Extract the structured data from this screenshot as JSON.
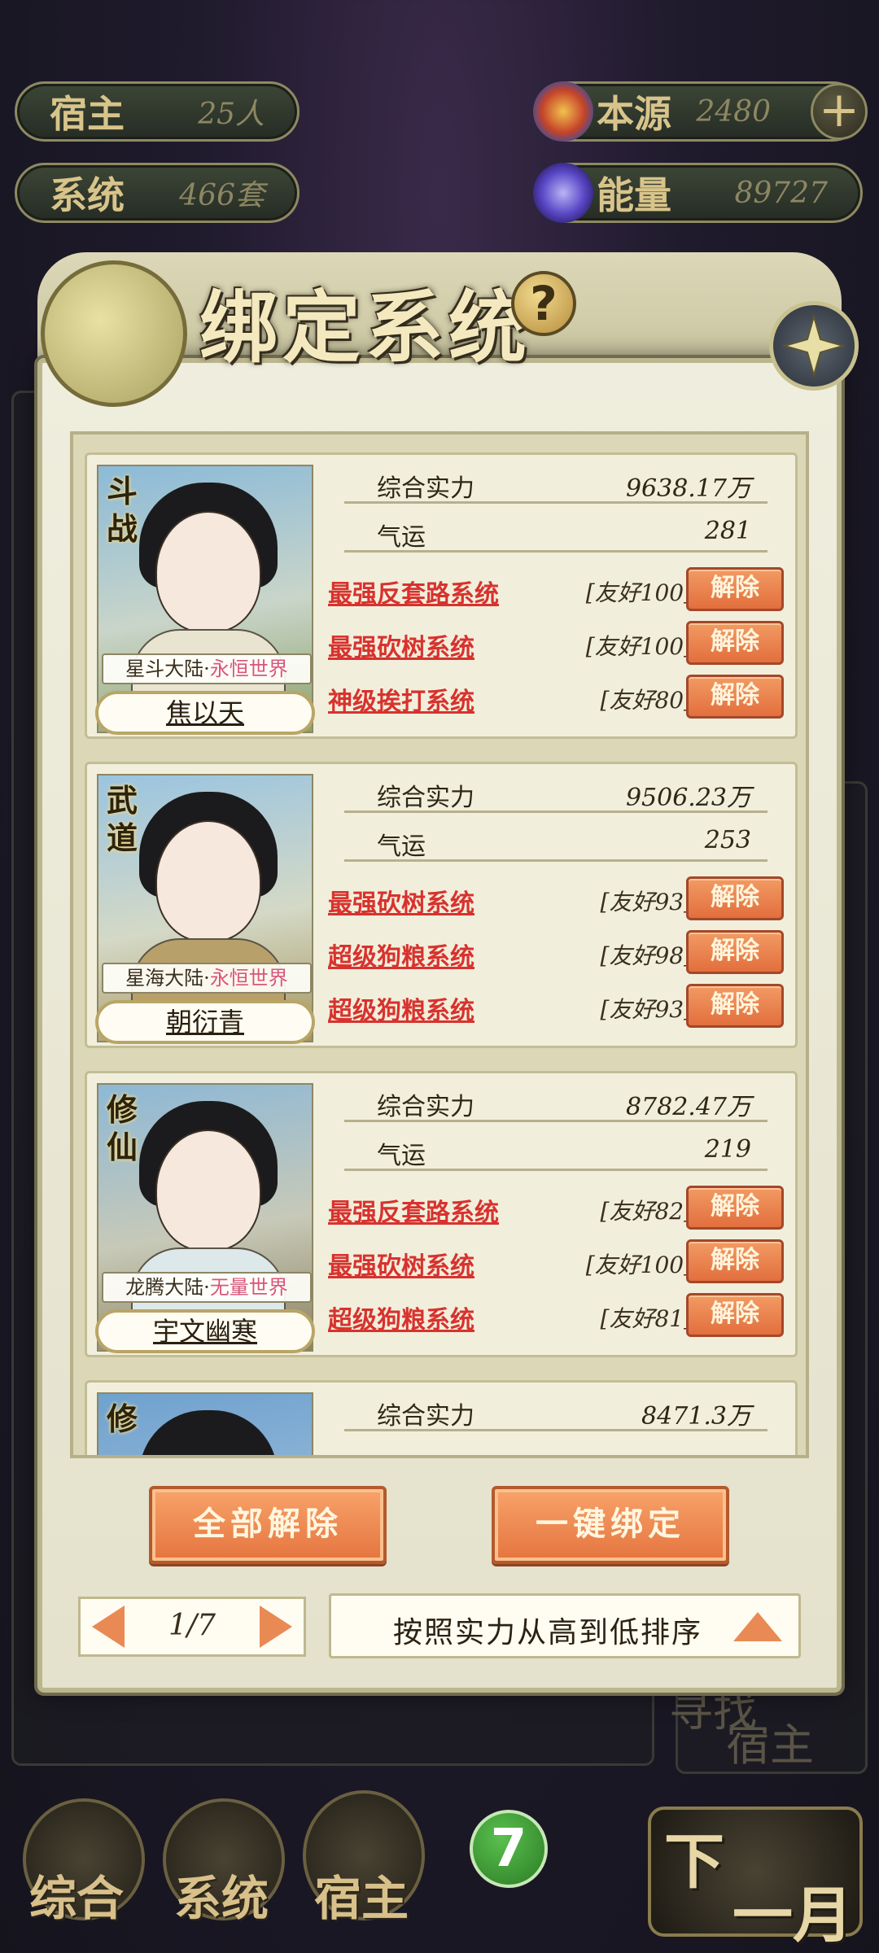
{
  "resources": {
    "host": {
      "label": "宿主",
      "value": "25人"
    },
    "system": {
      "label": "系统",
      "value": "466套"
    },
    "origin": {
      "label": "本源",
      "value": "2480"
    },
    "energy": {
      "label": "能量",
      "value": "89727"
    }
  },
  "modal": {
    "title": "绑定系统",
    "help": "?",
    "stat_power_label": "综合实力",
    "stat_luck_label": "气运",
    "unbind_label": "解除"
  },
  "cards": [
    {
      "sect": "斗战",
      "origin_land": "星斗大陆·",
      "origin_realm": "永恒世界",
      "name": "焦以天",
      "power": "9638.17万",
      "luck": "281",
      "systems": [
        {
          "name": "最强反套路系统",
          "favor": "[友好100]"
        },
        {
          "name": "最强砍树系统",
          "favor": "[友好100]"
        },
        {
          "name": "神级挨打系统",
          "favor": "[友好80]"
        }
      ]
    },
    {
      "sect": "武道",
      "origin_land": "星海大陆·",
      "origin_realm": "永恒世界",
      "name": "朝衍青",
      "power": "9506.23万",
      "luck": "253",
      "systems": [
        {
          "name": "最强砍树系统",
          "favor": "[友好93]"
        },
        {
          "name": "超级狗粮系统",
          "favor": "[友好98]"
        },
        {
          "name": "超级狗粮系统",
          "favor": "[友好93]"
        }
      ]
    },
    {
      "sect": "修仙",
      "origin_land": "龙腾大陆·",
      "origin_realm": "无量世界",
      "name": "宇文幽寒",
      "power": "8782.47万",
      "luck": "219",
      "systems": [
        {
          "name": "最强反套路系统",
          "favor": "[友好82]"
        },
        {
          "name": "最强砍树系统",
          "favor": "[友好100]"
        },
        {
          "name": "超级狗粮系统",
          "favor": "[友好81]"
        }
      ]
    },
    {
      "sect": "修",
      "power": "8471.3万"
    }
  ],
  "actions": {
    "unbind_all": "全部解除",
    "one_click_bind": "一键绑定"
  },
  "pager": {
    "current": "1/7"
  },
  "sort": {
    "label": "按照实力从高到低排序"
  },
  "bottom_nav": {
    "overview": "综合",
    "system": "系统",
    "host": "宿主",
    "badge": "7",
    "next_month_1": "下",
    "next_month_2": "一月",
    "find_host_1": "寻找",
    "find_host_2": "宿主"
  },
  "colors": {
    "accent": "#e5743f",
    "link_red": "#d8322e",
    "realm_pink": "#d8567a"
  }
}
